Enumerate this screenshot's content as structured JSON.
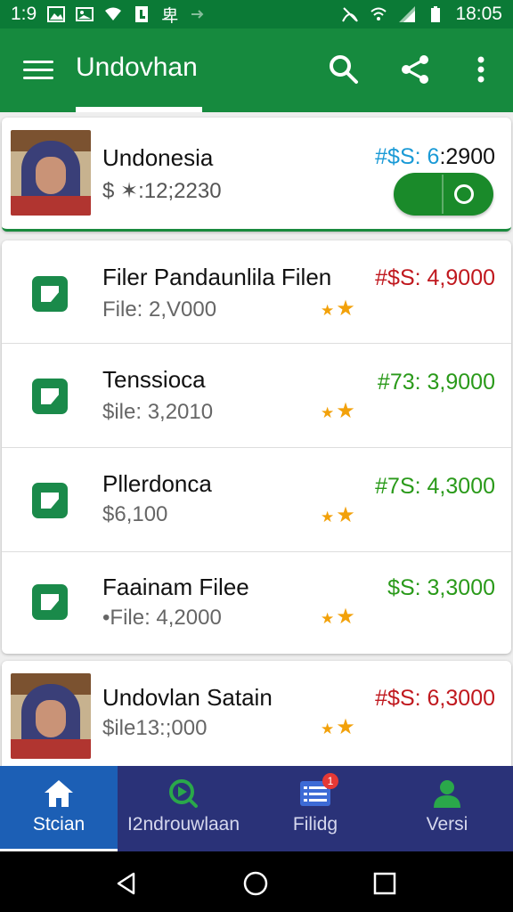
{
  "status_bar": {
    "time_left": "1:9",
    "clock": "18:05",
    "left_icons": [
      "image-icon",
      "gallery-icon",
      "wifi-icon",
      "sim-icon",
      "chinese-char-icon",
      "arrow-icon"
    ],
    "left_char": "卑",
    "right_icons": [
      "no-signal-icon",
      "wifi-icon",
      "cell-signal-icon",
      "battery-icon"
    ]
  },
  "appbar": {
    "title": "Undovhan",
    "icons": [
      "menu-icon",
      "search-icon",
      "share-icon",
      "more-vert-icon"
    ]
  },
  "featured": {
    "title": "Undonesia",
    "subtitle": "$ ✶:12;2230",
    "price_prefix": "#$S: 6",
    "price_suffix": ":2900",
    "toggle_on": true
  },
  "list": [
    {
      "title": "Filer Pandaunlila Filen",
      "subtitle": "File: 2,V000",
      "price": "#$S: 4,9000",
      "price_color": "#c0181e",
      "stars": "★★"
    },
    {
      "title": "Tenssioca",
      "subtitle": "$ile: 3,2010",
      "price": "#73: 3,9000",
      "price_color": "#2a9a1a",
      "stars": "★★"
    },
    {
      "title": "Pllerdonca",
      "subtitle": "$6,100",
      "price": "#7S: 4,3000",
      "price_color": "#2a9a1a",
      "stars": "★★"
    },
    {
      "title": "Faainam Filee",
      "subtitle": "•File: 4,2000",
      "price": "$S: 3,3000",
      "price_color": "#2a9a1a",
      "stars": "★★"
    }
  ],
  "bottom_item": {
    "title": "Undovlan Satain",
    "subtitle": "$ile13:;000",
    "price": "#$S: 6,3000",
    "price_color": "#c0181e",
    "stars": "★★"
  },
  "bottom_nav": [
    {
      "label": "Stcian",
      "icon": "home-icon",
      "active": true
    },
    {
      "label": "I2ndrouwlaan",
      "icon": "play-search-icon",
      "active": false
    },
    {
      "label": "Filidg",
      "icon": "list-icon",
      "active": false,
      "badge": "1"
    },
    {
      "label": "Versi",
      "icon": "person-icon",
      "active": false
    }
  ],
  "colors": {
    "status_bar": "#0b7a36",
    "appbar": "#168a3e",
    "accent_green": "#1a8a3e",
    "price_red": "#c0181e",
    "price_green": "#2a9a1a",
    "price_blue": "#1a9ad6",
    "nav_bg": "#2a3278",
    "nav_active": "#1c5fb5",
    "star": "#f2a10a"
  }
}
